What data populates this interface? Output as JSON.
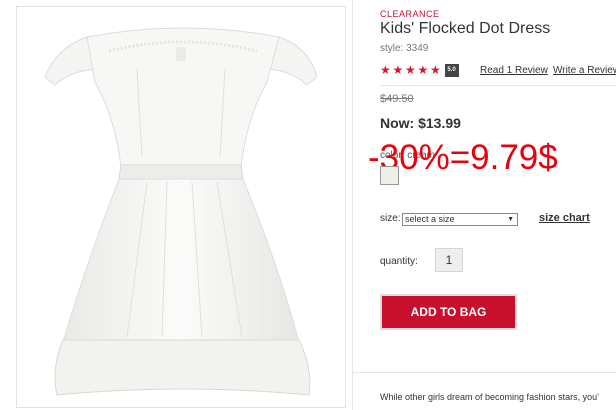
{
  "product": {
    "badge": "CLEARANCE",
    "title": "Kids' Flocked Dot Dress",
    "style": "style: 3349",
    "rating": {
      "stars": 5,
      "score_label": "5.0"
    },
    "read_review": "Read 1 Review",
    "write_review": "Write a Review",
    "was_price": "$49.50",
    "now_price": "Now: $13.99",
    "color_label": "color: cream",
    "overlay_text": "-30%=9.79$",
    "size_label": "size:",
    "size_select": "select a size",
    "size_chart": "size chart",
    "quantity_label": "quantity:",
    "quantity_value": "1",
    "add_to_bag": "ADD TO BAG",
    "description": "While other girls dream of becoming fashion stars, you'"
  },
  "colors": {
    "accent": "#c8102e",
    "overlay": "#e8000d",
    "swatch": "#efefe9"
  },
  "icons": {
    "star": "star-icon",
    "dropdown": "chevron-down-icon"
  }
}
